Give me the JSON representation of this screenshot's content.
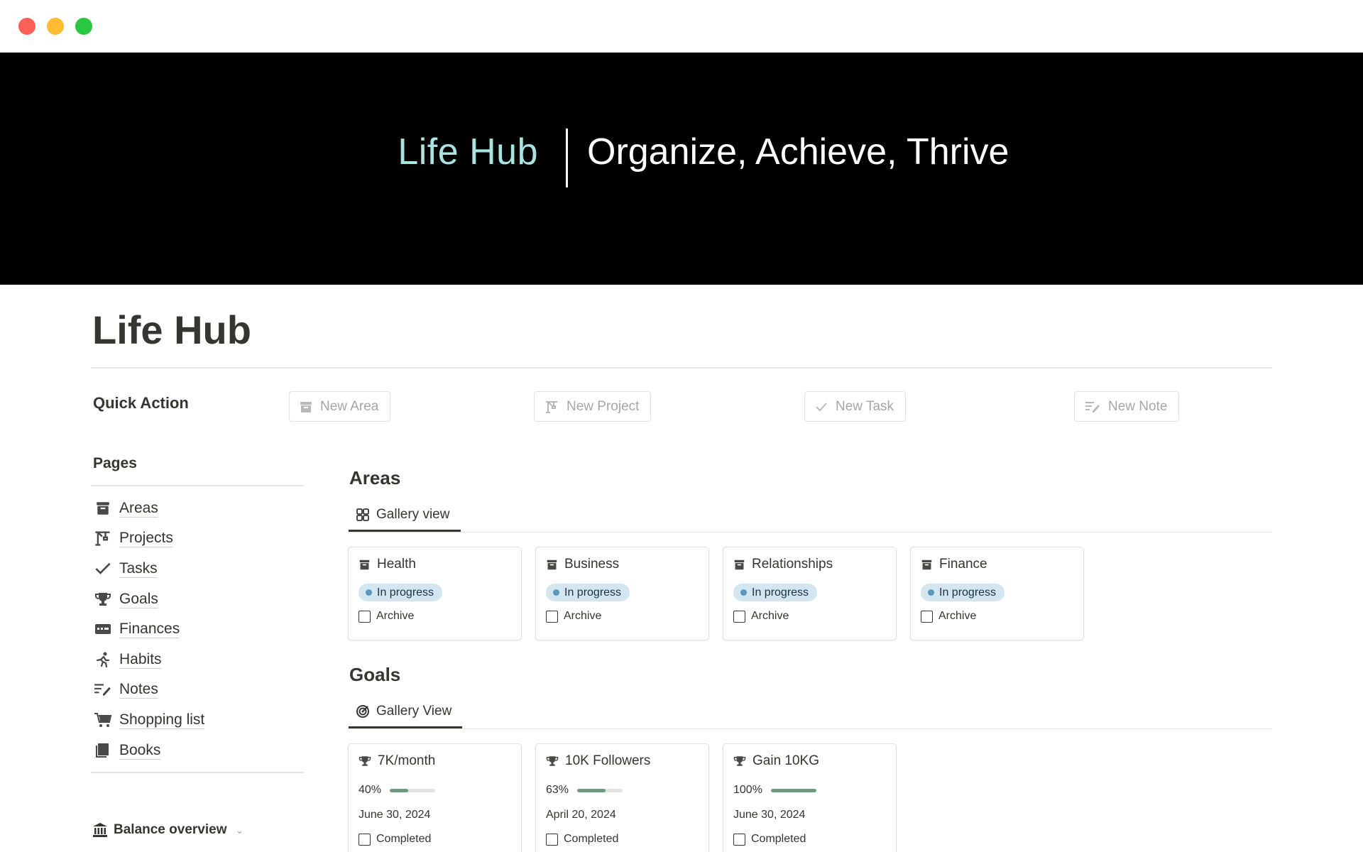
{
  "banner": {
    "title_left": "Life Hub",
    "title_right": "Organize, Achieve, Thrive"
  },
  "page": {
    "title": "Life Hub"
  },
  "quick_action": {
    "label": "Quick Action",
    "buttons": [
      {
        "label": "New Area",
        "icon": "archive-box-icon"
      },
      {
        "label": "New Project",
        "icon": "crane-icon"
      },
      {
        "label": "New Task",
        "icon": "checkmark-icon"
      },
      {
        "label": "New Note",
        "icon": "note-pencil-icon"
      }
    ]
  },
  "sidebar": {
    "title": "Pages",
    "items": [
      {
        "label": "Areas",
        "icon": "archive-box-icon"
      },
      {
        "label": "Projects",
        "icon": "crane-icon"
      },
      {
        "label": "Tasks",
        "icon": "checkmark-icon"
      },
      {
        "label": "Goals",
        "icon": "trophy-icon"
      },
      {
        "label": "Finances",
        "icon": "money-icon"
      },
      {
        "label": "Habits",
        "icon": "runner-icon"
      },
      {
        "label": "Notes",
        "icon": "note-pencil-icon"
      },
      {
        "label": "Shopping list",
        "icon": "cart-icon"
      },
      {
        "label": "Books",
        "icon": "book-icon"
      }
    ],
    "balance": {
      "label": "Balance overview",
      "icon": "bank-icon"
    }
  },
  "areas": {
    "title": "Areas",
    "view_tab": "Gallery view",
    "cards": [
      {
        "title": "Health",
        "status": "In progress",
        "checkbox_label": "Archive",
        "checked": false
      },
      {
        "title": "Business",
        "status": "In progress",
        "checkbox_label": "Archive",
        "checked": false
      },
      {
        "title": "Relationships",
        "status": "In progress",
        "checkbox_label": "Archive",
        "checked": false
      },
      {
        "title": "Finance",
        "status": "In progress",
        "checkbox_label": "Archive",
        "checked": false
      }
    ]
  },
  "goals": {
    "title": "Goals",
    "view_tab": "Gallery View",
    "cards": [
      {
        "title": "7K/month",
        "progress_label": "40%",
        "progress": 0.4,
        "date": "June 30, 2024",
        "checkbox_label": "Completed"
      },
      {
        "title": "10K Followers",
        "progress_label": "63%",
        "progress": 0.63,
        "date": "April 20, 2024",
        "checkbox_label": "Completed"
      },
      {
        "title": "Gain 10KG",
        "progress_label": "100%",
        "progress": 1.0,
        "date": "June 30, 2024",
        "checkbox_label": "Completed"
      }
    ]
  },
  "colors": {
    "banner_bg": "#000000",
    "banner_accent": "#a9e4e1",
    "status_pill_bg": "#d3e5ef",
    "status_dot": "#5a97bd",
    "progress_fill": "#6c9b7d"
  }
}
